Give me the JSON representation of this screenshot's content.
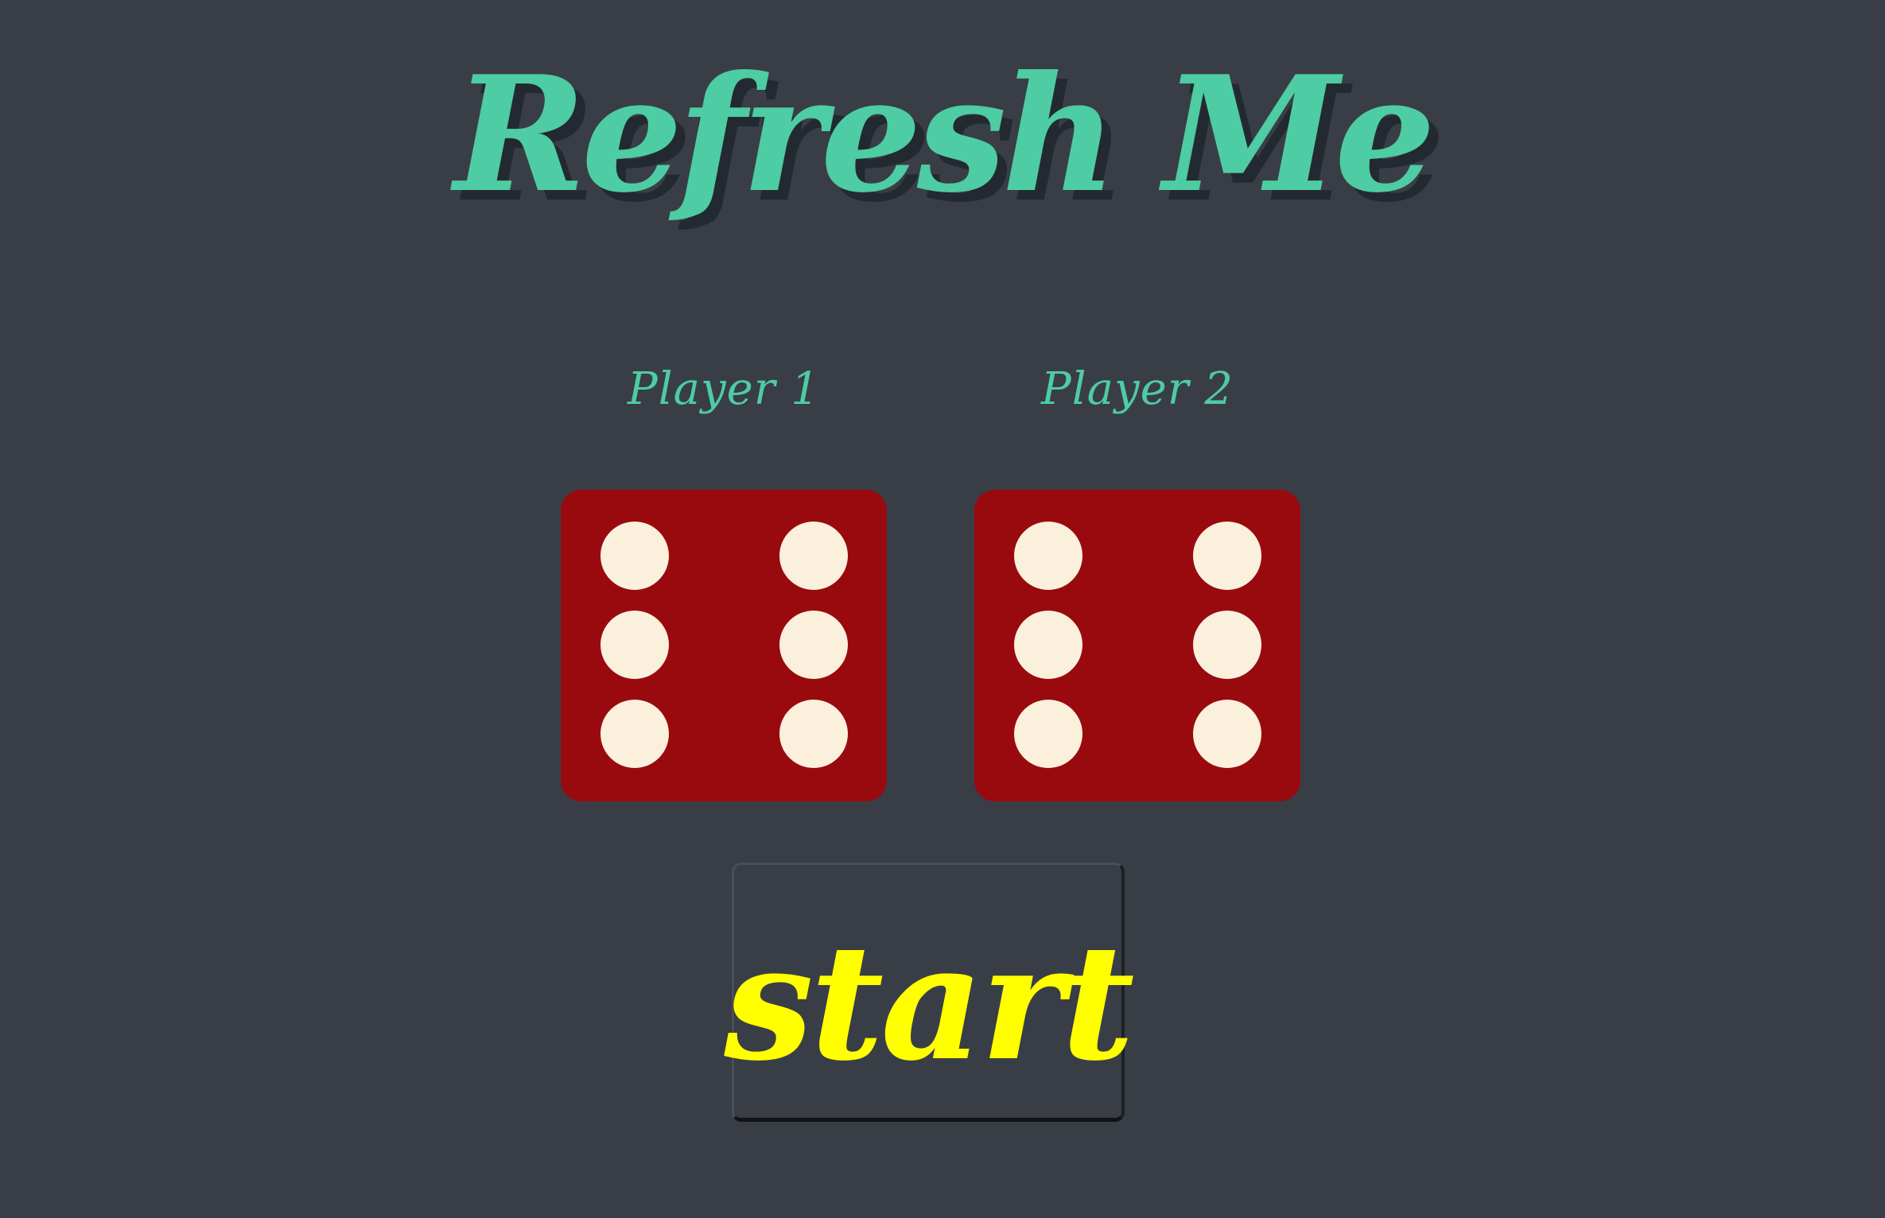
{
  "game": {
    "title": "Refresh Me",
    "players": [
      {
        "label": "Player 1",
        "die_value": 6
      },
      {
        "label": "Player 2",
        "die_value": 6
      }
    ],
    "start_label": "start"
  },
  "colors": {
    "background": "#393e46",
    "title": "#4ecca3",
    "title_shadow": "#232931",
    "die_face": "#990a0f",
    "die_pip": "#faf0dc",
    "start_text": "#ffff00"
  }
}
